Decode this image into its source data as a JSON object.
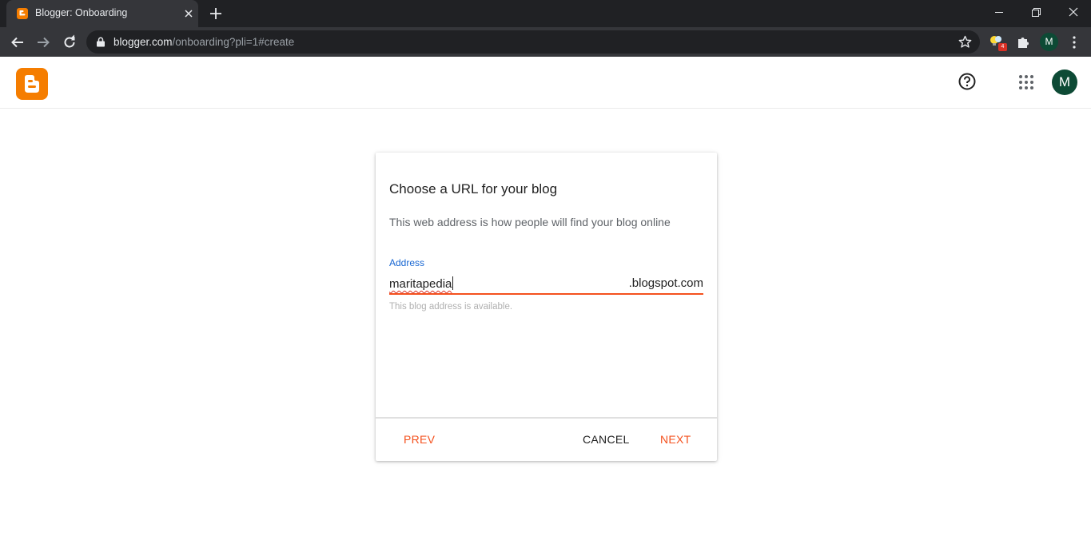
{
  "browser": {
    "tab_title": "Blogger: Onboarding",
    "url_host": "blogger.com",
    "url_path": "/onboarding?pli=1#create",
    "extension_badge": "4",
    "profile_initial": "M"
  },
  "header": {
    "avatar_initial": "M",
    "brand_color": "#f57d00"
  },
  "dialog": {
    "title": "Choose a URL for your blog",
    "description": "This web address is how people will find your blog online",
    "field_label": "Address",
    "field_value": "maritapedia",
    "field_suffix": ".blogspot.com",
    "hint": "This blog address is available.",
    "prev_label": "PREV",
    "cancel_label": "CANCEL",
    "next_label": "NEXT",
    "accent_color": "#f4511e"
  }
}
